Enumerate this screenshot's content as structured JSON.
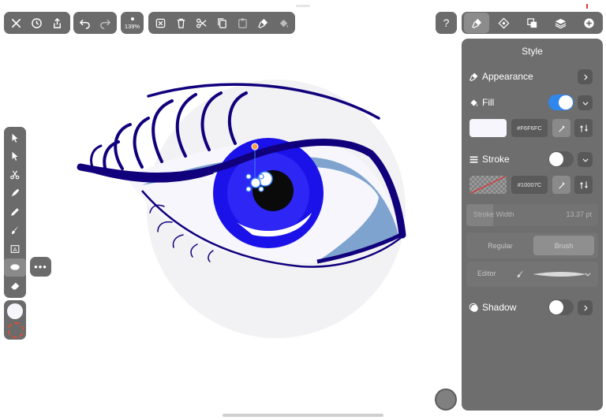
{
  "toolbar": {
    "zoom_label": "139%"
  },
  "panel": {
    "title": "Style",
    "appearance_label": "Appearance",
    "fill": {
      "label": "Fill",
      "hex": "#F6F6FC",
      "swatch_color": "#f6f6fc",
      "enabled": true
    },
    "stroke": {
      "label": "Stroke",
      "hex": "#10007C",
      "enabled": false
    },
    "stroke_width": {
      "label": "Stroke Width",
      "value": "13.37 pt"
    },
    "modes": [
      "Regular",
      "Brush"
    ],
    "active_mode": "Brush",
    "editor_label": "Editor",
    "shadow": {
      "label": "Shadow",
      "enabled": false
    }
  },
  "colors": {
    "toolbar_bg": "#6b6b6b",
    "panel_bg": "#6e6e6e",
    "toggle_on": "#2f86ec",
    "iris": "#1a12e8",
    "dark_navy": "#10007c",
    "canvas_circle": "#f2f2f4"
  }
}
